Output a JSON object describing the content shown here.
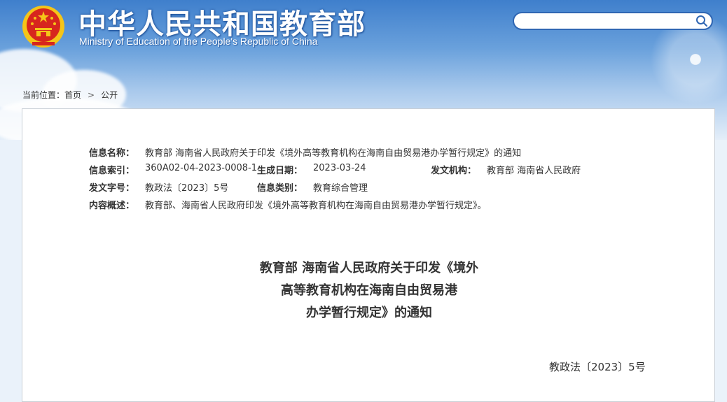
{
  "header": {
    "title_cn": "中华人民共和国教育部",
    "title_en": "Ministry of Education of the People's Republic of China",
    "search": {
      "value": "",
      "placeholder": ""
    }
  },
  "breadcrumb": {
    "prefix": "当前位置：",
    "items": [
      "首页",
      "公开"
    ],
    "separator": ">"
  },
  "meta": {
    "name_label": "信息名称：",
    "name_value": "教育部 海南省人民政府关于印发《境外高等教育机构在海南自由贸易港办学暂行规定》的通知",
    "index_label": "信息索引：",
    "index_value": "360A02-04-2023-0008-1",
    "date_label": "生成日期：",
    "date_value": "2023-03-24",
    "org_label": "发文机构：",
    "org_value": "教育部 海南省人民政府",
    "docno_label": "发文字号：",
    "docno_value": "教政法〔2023〕5号",
    "type_label": "信息类别：",
    "type_value": "教育综合管理",
    "summary_label": "内容概述：",
    "summary_value": "教育部、海南省人民政府印发《境外高等教育机构在海南自由贸易港办学暂行规定》。"
  },
  "document": {
    "title_lines": [
      "教育部 海南省人民政府关于印发《境外",
      "高等教育机构在海南自由贸易港",
      "办学暂行规定》的通知"
    ],
    "number": "教政法〔2023〕5号"
  },
  "colors": {
    "banner_top": "#3f7fcc",
    "search_border": "#2f66b3",
    "emblem_red": "#d7261e",
    "emblem_gold": "#f5c518"
  }
}
